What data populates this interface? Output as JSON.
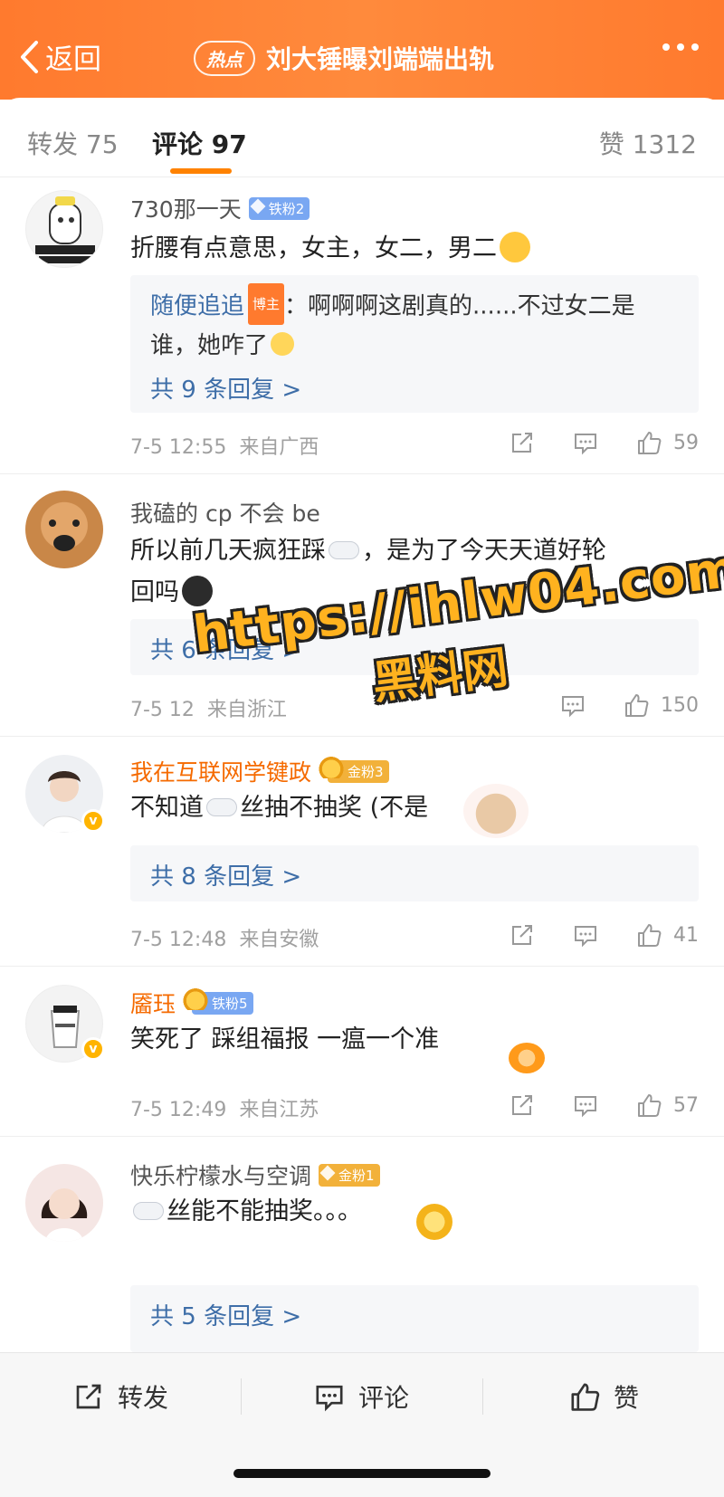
{
  "header": {
    "back_label": "返回",
    "hot_badge": "热点",
    "title": "刘大锤曝刘端端出轨"
  },
  "tabs": {
    "forward": "转发 75",
    "comment": "评论 97",
    "like": "赞 1312"
  },
  "comments": [
    {
      "username": "730那一天",
      "fan_badge": "铁粉2",
      "text": "折腰有点意思，女主，女二，男二",
      "reply": {
        "name": "随便追追",
        "role_badge": "博主",
        "text_a": "：啊啊啊这剧真的......不过女二是",
        "text_b": "谁，她咋了",
        "more": "共 9 条回复 >"
      },
      "time": "7-5 12:55",
      "location": "来自广西",
      "likes": "59"
    },
    {
      "username": "我磕的 cp 不会 be",
      "text_a": "所以前几天疯狂踩",
      "text_b": "，是为了今天天道好轮",
      "text_c": "回吗",
      "more": "共 6 条回复 >",
      "time": "7-5 12",
      "location": "来自浙江",
      "likes": "150"
    },
    {
      "username": "我在互联网学键政",
      "fan_badge": "金粉3",
      "text_a": "不知道",
      "text_b": "丝抽不抽奖 (不是",
      "more": "共 8 条回复 >",
      "time": "7-5 12:48",
      "location": "来自安徽",
      "likes": "41"
    },
    {
      "username": "靥珏",
      "fan_badge": "铁粉5",
      "text": "笑死了 踩组福报 一瘟一个准",
      "time": "7-5 12:49",
      "location": "来自江苏",
      "likes": "57"
    },
    {
      "username": "快乐柠檬水与空调",
      "fan_badge": "金粉1",
      "text": "丝能不能抽奖。。。",
      "more": "共 5 条回复 >"
    }
  ],
  "watermark": {
    "url": "https://ihlw04.com",
    "name": "黑料网"
  },
  "bottom_bar": {
    "forward": "转发",
    "comment": "评论",
    "like": "赞"
  },
  "colors": {
    "header_orange": "#ff7a2e",
    "tab_underline": "#ff8200",
    "reply_link": "#3e6ea8",
    "gold_name": "#f56a00"
  }
}
